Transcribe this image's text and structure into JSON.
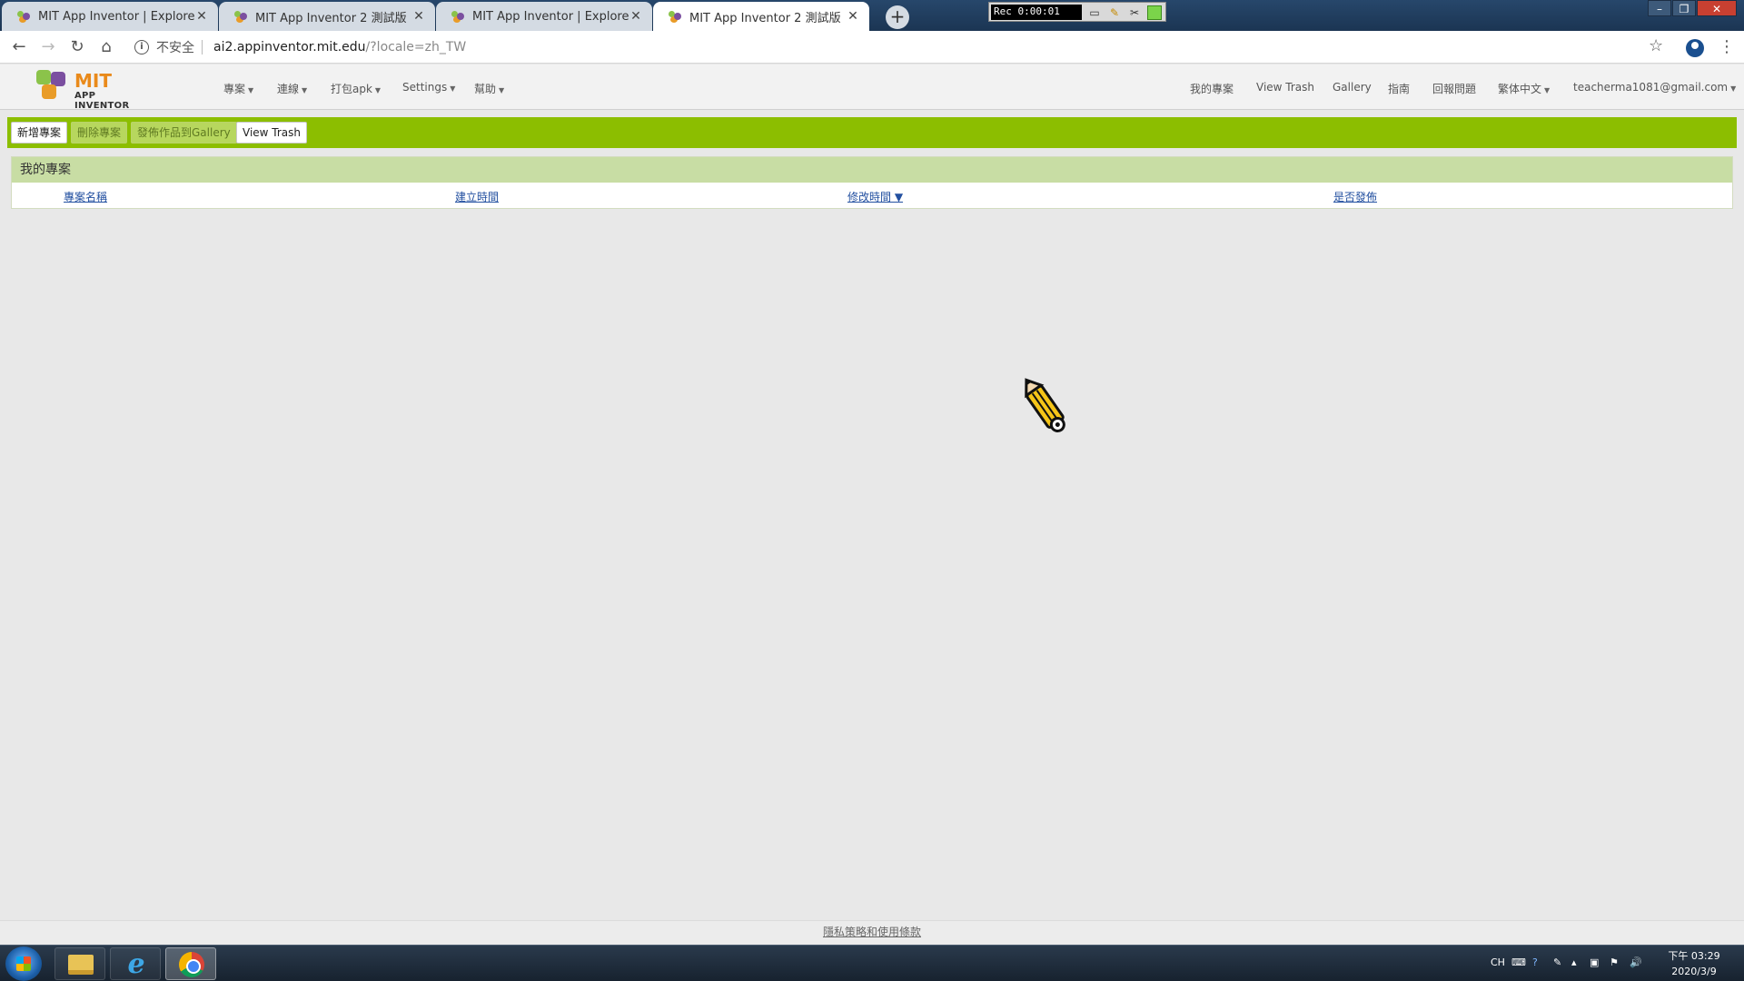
{
  "browser": {
    "tabs": [
      {
        "title": "MIT App Inventor | Explore MIT",
        "active": false
      },
      {
        "title": "MIT App Inventor 2 測試版",
        "active": false
      },
      {
        "title": "MIT App Inventor | Explore MIT",
        "active": false
      },
      {
        "title": "MIT App Inventor 2 測試版",
        "active": true
      }
    ],
    "new_tab_icon": "+",
    "recorder_time": "Rec 0:00:01",
    "address": {
      "security_label": "不安全",
      "host": "ai2.appinventor.mit.edu",
      "path": "/?locale=zh_TW"
    }
  },
  "app": {
    "logo": {
      "line1": "MIT",
      "line2": "APP INVENTOR"
    },
    "menu_left": [
      "專案",
      "連線",
      "打包apk",
      "Settings",
      "幫助"
    ],
    "menu_right": [
      "我的專案",
      "View Trash",
      "Gallery",
      "指南",
      "回報問題",
      "繁体中文",
      "teacherma1081@gmail.com"
    ],
    "actions": [
      {
        "label": "新增專案",
        "enabled": true
      },
      {
        "label": "刪除專案",
        "enabled": false
      },
      {
        "label": "發佈作品到Gallery",
        "enabled": false
      },
      {
        "label": "View Trash",
        "enabled": true
      }
    ],
    "panel_title": "我的專案",
    "columns": [
      "專案名稱",
      "建立時間",
      "修改時間 ▼",
      "是否發佈"
    ],
    "footer_link": "隱私策略和使用條款"
  },
  "taskbar": {
    "lang": "CH",
    "clock_time": "下午 03:29",
    "clock_date": "2020/3/9"
  },
  "colors": {
    "action_bar": "#8cbe00",
    "panel_header": "#c8dda4",
    "link": "#2350a0"
  }
}
